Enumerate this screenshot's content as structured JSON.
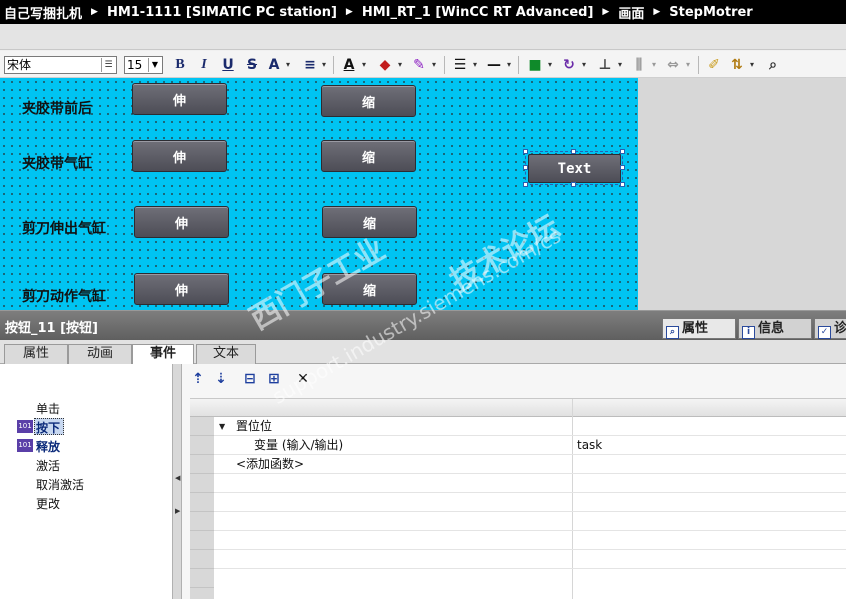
{
  "breadcrumb": [
    "自己写捆扎机",
    "HM1-1111 [SIMATIC PC station]",
    "HMI_RT_1 [WinCC RT Advanced]",
    "画面",
    "StepMotrer"
  ],
  "toolbar": {
    "font_name": "宋体",
    "font_size": "15",
    "bold": "B",
    "italic": "I",
    "underline": "U",
    "strike": "S",
    "font_up": "A",
    "font_color": "A",
    "pick_icon": "zoom-select-icon"
  },
  "canvas": {
    "rows": [
      {
        "label": "夹胶带前后",
        "extend": "伸",
        "retract": "缩"
      },
      {
        "label": "夹胶带气缸",
        "extend": "伸",
        "retract": "缩"
      },
      {
        "label": "剪刀伸出气缸",
        "extend": "伸",
        "retract": "缩"
      },
      {
        "label": "剪刀动作气缸",
        "extend": "伸",
        "retract": "缩"
      }
    ],
    "text_button": "Text",
    "background_color": "#00c4f2"
  },
  "inspector": {
    "title": "按钮_11 [按钮]",
    "tabs": [
      {
        "label": "属性",
        "icon": "properties-icon"
      },
      {
        "label": "信息",
        "icon": "info-icon"
      },
      {
        "label": "诊",
        "icon": "diagnostics-icon"
      }
    ],
    "subtabs": [
      "属性",
      "动画",
      "事件",
      "文本"
    ],
    "active_subtab": "事件"
  },
  "events": [
    {
      "label": "单击",
      "has_icon": false
    },
    {
      "label": "按下",
      "has_icon": true,
      "selected": true
    },
    {
      "label": "释放",
      "has_icon": true
    },
    {
      "label": "激活",
      "has_icon": false
    },
    {
      "label": "取消激活",
      "has_icon": false
    },
    {
      "label": "更改",
      "has_icon": false
    }
  ],
  "function_list": {
    "function_name": "置位位",
    "param_name": "变量 (输入/输出)",
    "param_value": "task",
    "add_function": "<添加函数>"
  },
  "watermark": {
    "line1": "西门子工业",
    "line2": "support.industry.siemens.com/cs",
    "line3": "技术论坛"
  }
}
